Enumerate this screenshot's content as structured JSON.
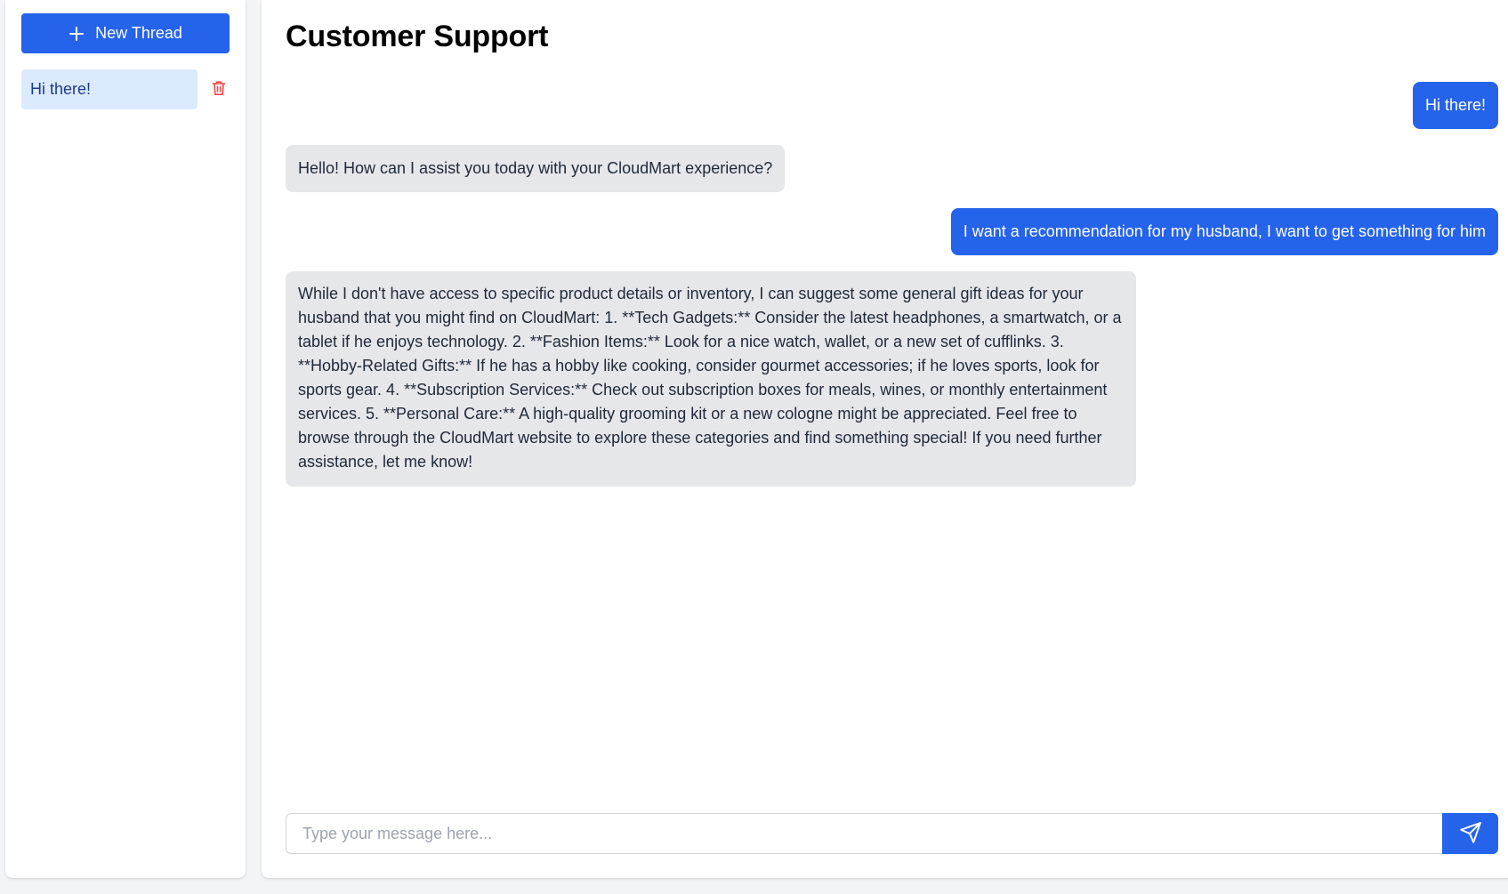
{
  "sidebar": {
    "new_thread_label": "New Thread",
    "new_thread_icon": "plus-icon",
    "threads": [
      {
        "title": "Hi there!",
        "active": true,
        "delete_icon": "trash-icon"
      }
    ]
  },
  "main": {
    "title": "Customer Support",
    "messages": [
      {
        "role": "user",
        "text": "Hi there!"
      },
      {
        "role": "assistant",
        "text": "Hello! How can I assist you today with your CloudMart experience?"
      },
      {
        "role": "user",
        "text": "I want a recommendation for my husband, I want to get something for him"
      },
      {
        "role": "assistant",
        "text": "While I don't have access to specific product details or inventory, I can suggest some general gift ideas for your husband that you might find on CloudMart: 1. **Tech Gadgets:** Consider the latest headphones, a smartwatch, or a tablet if he enjoys technology. 2. **Fashion Items:** Look for a nice watch, wallet, or a new set of cufflinks. 3. **Hobby-Related Gifts:** If he has a hobby like cooking, consider gourmet accessories; if he loves sports, look for sports gear. 4. **Subscription Services:** Check out subscription boxes for meals, wines, or monthly entertainment services. 5. **Personal Care:** A high-quality grooming kit or a new cologne might be appreciated. Feel free to browse through the CloudMart website to explore these categories and find something special! If you need further assistance, let me know!"
      }
    ],
    "composer": {
      "value": "",
      "placeholder": "Type your message here...",
      "send_icon": "send-icon"
    }
  },
  "colors": {
    "accent": "#2563eb",
    "thread_active_bg": "#dbeafe",
    "bot_bubble_bg": "#e5e7eb",
    "delete_icon": "#ef4444",
    "page_bg": "#f3f4f6"
  }
}
